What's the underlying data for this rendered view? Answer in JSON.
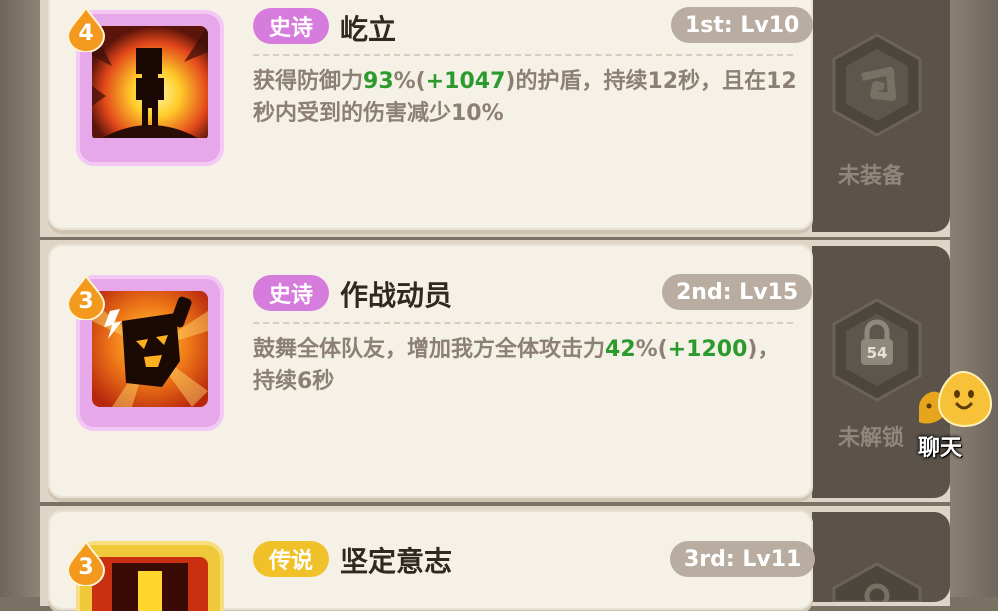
{
  "skills": [
    {
      "level": "4",
      "rarity": "史诗",
      "name": "屹立",
      "rank": "1st: Lv10",
      "desc_a": "获得防御力",
      "desc_hl1": "93",
      "desc_b": "%(",
      "desc_hl2": "+1047",
      "desc_c": ")的护盾，持续12秒，且在12秒内受到的伤害减少10%",
      "slot_status": "未装备",
      "slot_icon": "equip-hex-icon"
    },
    {
      "level": "3",
      "rarity": "史诗",
      "name": "作战动员",
      "rank": "2nd: Lv15",
      "desc_a": "鼓舞全体队友，增加我方全体攻击力",
      "desc_hl1": "42",
      "desc_b": "%(",
      "desc_hl2": "+1200",
      "desc_c": ")，持续6秒",
      "slot_status": "未解锁",
      "slot_lock_level": "54",
      "slot_icon": "lock-icon"
    },
    {
      "level": "3",
      "rarity": "传说",
      "name": "坚定意志",
      "rank": "3rd: Lv11"
    }
  ],
  "chat_button": {
    "label": "聊天",
    "icon": "chat-mascot-icon"
  },
  "colors": {
    "epic": "#d67cdc",
    "legendary": "#f1c12a",
    "highlight": "#2c9a2c"
  }
}
